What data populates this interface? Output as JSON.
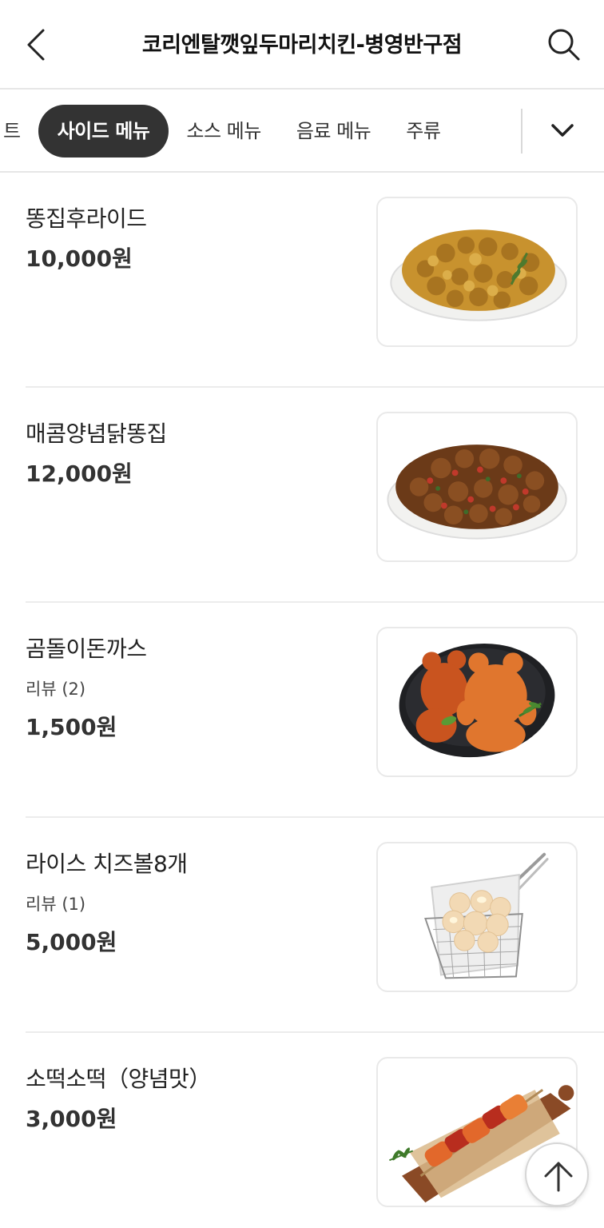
{
  "header": {
    "title": "코리엔탈깻잎두마리치킨-병영반구점",
    "back_icon": "chevron-left-icon",
    "search_icon": "search-icon"
  },
  "tabs": {
    "items": [
      {
        "label": "트"
      },
      {
        "label": "사이드 메뉴",
        "active": true
      },
      {
        "label": "소스 메뉴"
      },
      {
        "label": "음료 메뉴"
      },
      {
        "label": "주류"
      }
    ],
    "expand_icon": "chevron-down-icon"
  },
  "menu": [
    {
      "name": "똥집후라이드",
      "review": "",
      "price": "10,000원",
      "image": "fried-gizzard"
    },
    {
      "name": "매콤양념닭똥집",
      "review": "",
      "price": "12,000원",
      "image": "spicy-gizzard"
    },
    {
      "name": "곰돌이돈까스",
      "review": "리뷰 (2)",
      "price": "1,500원",
      "image": "bear-cutlet"
    },
    {
      "name": "라이스 치즈볼8개",
      "review": "리뷰 (1)",
      "price": "5,000원",
      "image": "cheese-balls"
    },
    {
      "name": "소떡소떡（양념맛）",
      "review": "",
      "price": "3,000원",
      "image": "sotteok"
    }
  ],
  "scroll_top_icon": "arrow-up-icon",
  "colors": {
    "active_tab_bg": "#333333",
    "divider": "#ececec"
  }
}
